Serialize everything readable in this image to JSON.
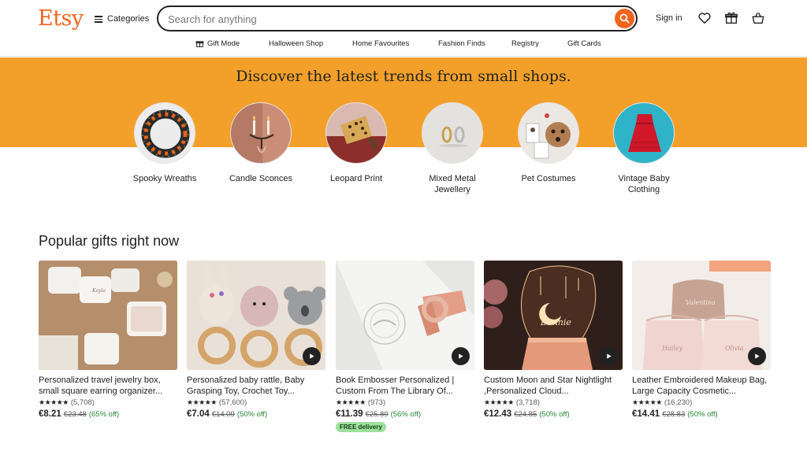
{
  "header": {
    "logo": "Etsy",
    "categories_label": "Categories",
    "search_placeholder": "Search for anything",
    "signin_label": "Sign in",
    "icons": [
      "search-icon",
      "heart-icon",
      "gift-icon",
      "basket-icon"
    ]
  },
  "subnav": {
    "items": [
      {
        "label": "Gift Mode",
        "icon": "gift-icon"
      },
      {
        "label": "Halloween Shop"
      },
      {
        "label": "Home Favourites"
      },
      {
        "label": "Fashion Finds"
      },
      {
        "label": "Registry"
      },
      {
        "label": "Gift Cards"
      }
    ]
  },
  "banner": {
    "title": "Discover the latest trends from small shops.",
    "color": "#f3a02b",
    "categories": [
      {
        "label": "Spooky Wreaths"
      },
      {
        "label": "Candle Sconces"
      },
      {
        "label": "Leopard Print"
      },
      {
        "label": "Mixed Metal Jewellery"
      },
      {
        "label": "Pet Costumes"
      },
      {
        "label": "Vintage Baby Clothing"
      }
    ]
  },
  "popular": {
    "title": "Popular gifts right now",
    "items": [
      {
        "title": "Personalized travel jewelry box, small square earring organizer...",
        "stars": "★★★★★",
        "reviews": "(5,708)",
        "price": "€8.21",
        "was": "€23.48",
        "off": "(65% off)"
      },
      {
        "title": "Personalized baby rattle, Baby Grasping Toy, Crochet Toy...",
        "stars": "★★★★★",
        "reviews": "(57,600)",
        "price": "€7.04",
        "was": "€14.09",
        "off": "(50% off)"
      },
      {
        "title": "Book Embosser Personalized | Custom From The Library Of...",
        "stars": "★★★★★",
        "reviews": "(973)",
        "price": "€11.39",
        "was": "€25.89",
        "off": "(56% off)",
        "badge": "FREE delivery"
      },
      {
        "title": "Custom Moon and Star Nightlight ,Personalized Cloud...",
        "stars": "★★★★★",
        "reviews": "(3,718)",
        "price": "€12.43",
        "was": "€24.85",
        "off": "(50% off)"
      },
      {
        "title": "Leather Embroidered Makeup Bag, Large Capacity Cosmetic...",
        "stars": "★★★★★",
        "reviews": "(16,230)",
        "price": "€14.41",
        "was": "€28.83",
        "off": "(50% off)"
      }
    ]
  },
  "colors": {
    "brand": "#f1641e",
    "sale": "#258635"
  }
}
